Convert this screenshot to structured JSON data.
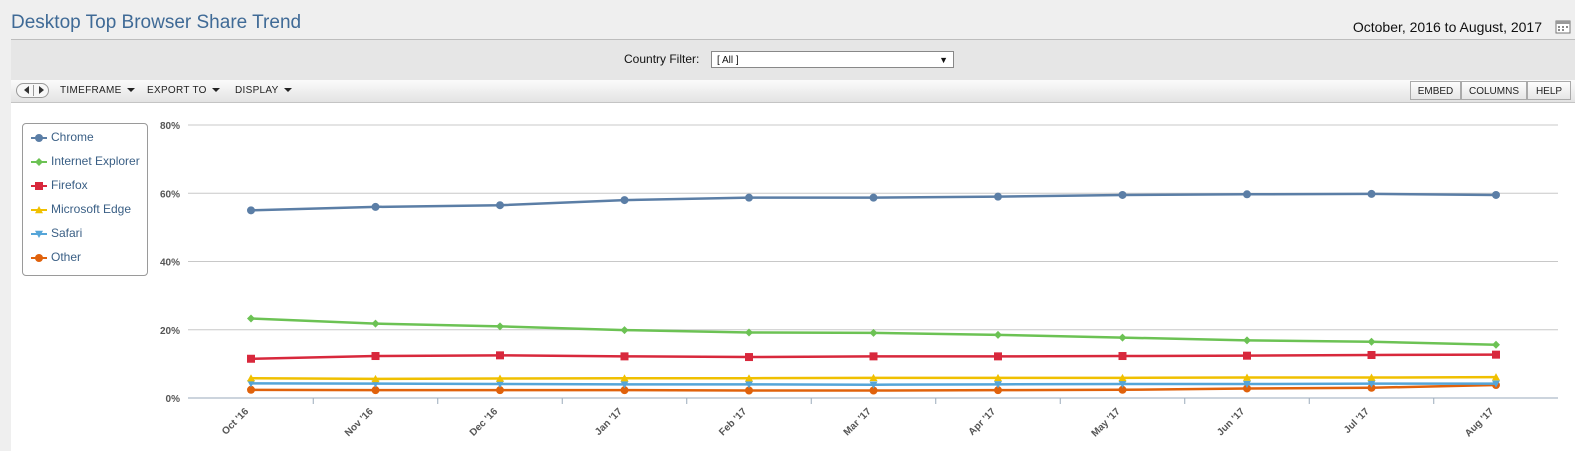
{
  "header": {
    "title": "Desktop Top Browser Share Trend",
    "date_range": "October, 2016 to August, 2017"
  },
  "filter": {
    "label": "Country Filter:",
    "value": "[ All ]"
  },
  "toolbar": {
    "timeframe": "TIMEFRAME",
    "export": "EXPORT TO",
    "display": "DISPLAY",
    "embed": "EMBED",
    "columns": "COLUMNS",
    "help": "HELP"
  },
  "chart_data": {
    "type": "line",
    "title": "",
    "xlabel": "",
    "ylabel": "",
    "x": [
      "Oct '16",
      "Nov '16",
      "Dec '16",
      "Jan '17",
      "Feb '17",
      "Mar '17",
      "Apr '17",
      "May '17",
      "Jun '17",
      "Jul '17",
      "Aug '17"
    ],
    "ylim": [
      0,
      80
    ],
    "y_ticks": [
      "0%",
      "20%",
      "40%",
      "60%",
      "80%"
    ],
    "grid": true,
    "legend_position": "top-left",
    "series": [
      {
        "name": "Chrome",
        "color": "#5b7ea6",
        "marker": "circle",
        "values": [
          55.0,
          56.0,
          56.5,
          58.0,
          58.7,
          58.7,
          59.0,
          59.5,
          59.7,
          59.8,
          59.5
        ]
      },
      {
        "name": "Internet Explorer",
        "color": "#6cc254",
        "marker": "diamond",
        "values": [
          23.3,
          21.8,
          21.0,
          19.9,
          19.2,
          19.1,
          18.5,
          17.7,
          16.9,
          16.5,
          15.6
        ]
      },
      {
        "name": "Firefox",
        "color": "#d8283c",
        "marker": "square",
        "values": [
          11.5,
          12.3,
          12.5,
          12.2,
          12.0,
          12.2,
          12.2,
          12.3,
          12.4,
          12.6,
          12.7
        ]
      },
      {
        "name": "Microsoft Edge",
        "color": "#f0c000",
        "marker": "triangle",
        "values": [
          5.8,
          5.6,
          5.7,
          5.8,
          5.8,
          5.9,
          5.9,
          5.9,
          6.0,
          6.0,
          6.1
        ]
      },
      {
        "name": "Safari",
        "color": "#55a5d8",
        "marker": "triangle-down",
        "values": [
          4.3,
          4.2,
          4.1,
          4.0,
          4.0,
          3.9,
          4.0,
          4.1,
          4.1,
          4.2,
          4.2
        ]
      },
      {
        "name": "Other",
        "color": "#e0620c",
        "marker": "circle",
        "values": [
          2.4,
          2.3,
          2.3,
          2.3,
          2.2,
          2.2,
          2.3,
          2.4,
          2.8,
          3.0,
          3.8
        ]
      }
    ]
  }
}
